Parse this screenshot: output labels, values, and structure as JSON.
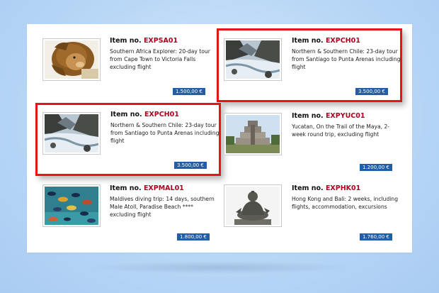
{
  "item_prefix": "Item no.",
  "tiles": [
    {
      "code": "EXPSA01",
      "desc": "Southern Africa Explorer: 20-day tour from Cape Town to Victoria Falls excluding flight",
      "price": "1.500,00 €",
      "image": "lion"
    },
    {
      "code": "EXPCH01",
      "desc": "Northern & Southern Chile: 23-day tour from Santiago to Punta Arenas including flight",
      "price": "3.500,00 €",
      "image": "river"
    },
    {
      "code": "EXPCH01",
      "desc": "Northern & Southern Chile: 23-day tour from Santiago to Punta Arenas including flight",
      "price": "3.500,00 €",
      "image": "river"
    },
    {
      "code": "EXPYUC01",
      "desc": "Yucatan, On the Trail of the Maya, 2-week round trip, excluding flight",
      "price": "1.200,00 €",
      "image": "pyramid"
    },
    {
      "code": "EXPMAL01",
      "desc": "Maldives diving trip: 14 days, southern Male Atoll, Paradise Beach **** excluding flight",
      "price": "1.800,00 €",
      "image": "fish"
    },
    {
      "code": "EXPHK01",
      "desc": "Hong Kong and Bali:  2 weeks, including flights, accommodation, excursions",
      "price": "1.760,00 €",
      "image": "buddha"
    }
  ],
  "colors": {
    "highlight": "#e3151a",
    "price_bg": "#1f5fa8",
    "code": "#b0001e"
  }
}
